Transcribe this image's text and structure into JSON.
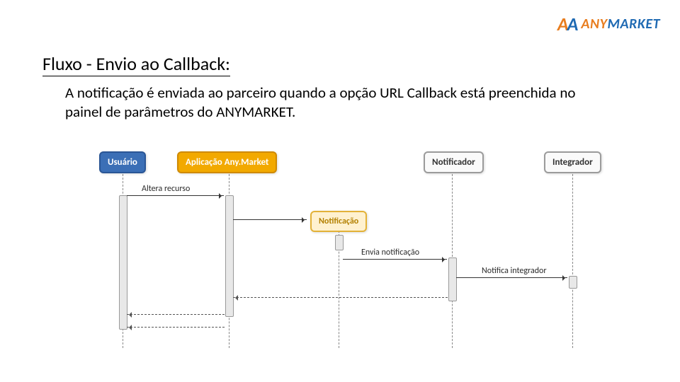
{
  "brand": {
    "mark_a": "A",
    "mark_v": "A",
    "word_any": "ANY",
    "word_market": "MARKET"
  },
  "title": "Fluxo - Envio ao Callback:",
  "description": "A notificação é enviada ao parceiro quando a opção URL Callback está preenchida no painel de parâmetros do ANYMARKET.",
  "participants": {
    "usuario": "Usuário",
    "app": "Aplicação Any.Market",
    "notificacao_obj": "Notificação",
    "notificador": "Notificador",
    "integrador": "Integrador"
  },
  "messages": {
    "altera_recurso": "Altera recurso",
    "envia_notificacao": "Envia notificação",
    "notifica_integrador": "Notifica integrador"
  }
}
